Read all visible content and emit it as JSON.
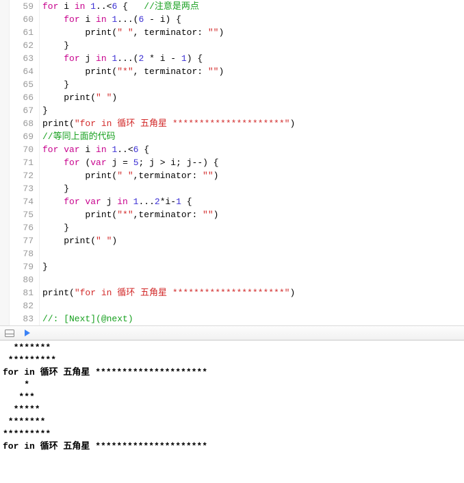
{
  "lines": [
    {
      "n": 59,
      "tokens": [
        {
          "t": "for ",
          "c": "kw"
        },
        {
          "t": "i ",
          "c": "plain"
        },
        {
          "t": "in ",
          "c": "kw"
        },
        {
          "t": "1",
          "c": "num"
        },
        {
          "t": "..<",
          "c": "plain"
        },
        {
          "t": "6",
          "c": "num"
        },
        {
          "t": " {   ",
          "c": "plain"
        },
        {
          "t": "//注意是两点",
          "c": "cmt"
        }
      ]
    },
    {
      "n": 60,
      "tokens": [
        {
          "t": "    ",
          "c": "plain"
        },
        {
          "t": "for ",
          "c": "kw"
        },
        {
          "t": "i ",
          "c": "plain"
        },
        {
          "t": "in ",
          "c": "kw"
        },
        {
          "t": "1",
          "c": "num"
        },
        {
          "t": "...(",
          "c": "plain"
        },
        {
          "t": "6",
          "c": "num"
        },
        {
          "t": " - i) {",
          "c": "plain"
        }
      ]
    },
    {
      "n": 61,
      "tokens": [
        {
          "t": "        print(",
          "c": "plain"
        },
        {
          "t": "\" \"",
          "c": "str"
        },
        {
          "t": ", terminator: ",
          "c": "plain"
        },
        {
          "t": "\"\"",
          "c": "str"
        },
        {
          "t": ")",
          "c": "plain"
        }
      ]
    },
    {
      "n": 62,
      "tokens": [
        {
          "t": "    }",
          "c": "plain"
        }
      ]
    },
    {
      "n": 63,
      "tokens": [
        {
          "t": "    ",
          "c": "plain"
        },
        {
          "t": "for ",
          "c": "kw"
        },
        {
          "t": "j ",
          "c": "plain"
        },
        {
          "t": "in ",
          "c": "kw"
        },
        {
          "t": "1",
          "c": "num"
        },
        {
          "t": "...(",
          "c": "plain"
        },
        {
          "t": "2",
          "c": "num"
        },
        {
          "t": " * i - ",
          "c": "plain"
        },
        {
          "t": "1",
          "c": "num"
        },
        {
          "t": ") {",
          "c": "plain"
        }
      ]
    },
    {
      "n": 64,
      "tokens": [
        {
          "t": "        print(",
          "c": "plain"
        },
        {
          "t": "\"*\"",
          "c": "str"
        },
        {
          "t": ", terminator: ",
          "c": "plain"
        },
        {
          "t": "\"\"",
          "c": "str"
        },
        {
          "t": ")",
          "c": "plain"
        }
      ]
    },
    {
      "n": 65,
      "tokens": [
        {
          "t": "    }",
          "c": "plain"
        }
      ]
    },
    {
      "n": 66,
      "tokens": [
        {
          "t": "    print(",
          "c": "plain"
        },
        {
          "t": "\" \"",
          "c": "str"
        },
        {
          "t": ")",
          "c": "plain"
        }
      ]
    },
    {
      "n": 67,
      "tokens": [
        {
          "t": "}",
          "c": "plain"
        }
      ]
    },
    {
      "n": 68,
      "tokens": [
        {
          "t": "print(",
          "c": "plain"
        },
        {
          "t": "\"for in 循环 五角星 *********************\"",
          "c": "str"
        },
        {
          "t": ")",
          "c": "plain"
        }
      ]
    },
    {
      "n": 69,
      "tokens": [
        {
          "t": "//等同上面的代码",
          "c": "cmt"
        }
      ]
    },
    {
      "n": 70,
      "tokens": [
        {
          "t": "for var ",
          "c": "kw"
        },
        {
          "t": "i ",
          "c": "plain"
        },
        {
          "t": "in ",
          "c": "kw"
        },
        {
          "t": "1",
          "c": "num"
        },
        {
          "t": "..<",
          "c": "plain"
        },
        {
          "t": "6",
          "c": "num"
        },
        {
          "t": " {",
          "c": "plain"
        }
      ]
    },
    {
      "n": 71,
      "tokens": [
        {
          "t": "    ",
          "c": "plain"
        },
        {
          "t": "for ",
          "c": "kw"
        },
        {
          "t": "(",
          "c": "plain"
        },
        {
          "t": "var ",
          "c": "kw"
        },
        {
          "t": "j = ",
          "c": "plain"
        },
        {
          "t": "5",
          "c": "num"
        },
        {
          "t": "; j > i; j--) {",
          "c": "plain"
        }
      ]
    },
    {
      "n": 72,
      "tokens": [
        {
          "t": "        print(",
          "c": "plain"
        },
        {
          "t": "\" \"",
          "c": "str"
        },
        {
          "t": ",terminator: ",
          "c": "plain"
        },
        {
          "t": "\"\"",
          "c": "str"
        },
        {
          "t": ")",
          "c": "plain"
        }
      ]
    },
    {
      "n": 73,
      "tokens": [
        {
          "t": "    }",
          "c": "plain"
        }
      ]
    },
    {
      "n": 74,
      "tokens": [
        {
          "t": "    ",
          "c": "plain"
        },
        {
          "t": "for var ",
          "c": "kw"
        },
        {
          "t": "j ",
          "c": "plain"
        },
        {
          "t": "in ",
          "c": "kw"
        },
        {
          "t": "1",
          "c": "num"
        },
        {
          "t": "...",
          "c": "plain"
        },
        {
          "t": "2",
          "c": "num"
        },
        {
          "t": "*i-",
          "c": "plain"
        },
        {
          "t": "1",
          "c": "num"
        },
        {
          "t": " {",
          "c": "plain"
        }
      ]
    },
    {
      "n": 75,
      "tokens": [
        {
          "t": "        print(",
          "c": "plain"
        },
        {
          "t": "\"*\"",
          "c": "str"
        },
        {
          "t": ",terminator: ",
          "c": "plain"
        },
        {
          "t": "\"\"",
          "c": "str"
        },
        {
          "t": ")",
          "c": "plain"
        }
      ]
    },
    {
      "n": 76,
      "tokens": [
        {
          "t": "    }",
          "c": "plain"
        }
      ]
    },
    {
      "n": 77,
      "tokens": [
        {
          "t": "    print(",
          "c": "plain"
        },
        {
          "t": "\" \"",
          "c": "str"
        },
        {
          "t": ")",
          "c": "plain"
        }
      ]
    },
    {
      "n": 78,
      "tokens": [
        {
          "t": "",
          "c": "plain"
        }
      ]
    },
    {
      "n": 79,
      "tokens": [
        {
          "t": "}",
          "c": "plain"
        }
      ]
    },
    {
      "n": 80,
      "tokens": [
        {
          "t": "",
          "c": "plain"
        }
      ]
    },
    {
      "n": 81,
      "tokens": [
        {
          "t": "print(",
          "c": "plain"
        },
        {
          "t": "\"for in 循环 五角星 *********************\"",
          "c": "str"
        },
        {
          "t": ")",
          "c": "plain"
        }
      ]
    },
    {
      "n": 82,
      "tokens": [
        {
          "t": "",
          "c": "plain"
        }
      ]
    },
    {
      "n": 83,
      "tokens": [
        {
          "t": "//: [Next](@next)",
          "c": "cmt"
        }
      ]
    }
  ],
  "console": [
    "  *******",
    " *********",
    "for in 循环 五角星 *********************",
    "    *",
    "   ***",
    "  *****",
    " *******",
    "*********",
    "for in 循环 五角星 *********************"
  ]
}
